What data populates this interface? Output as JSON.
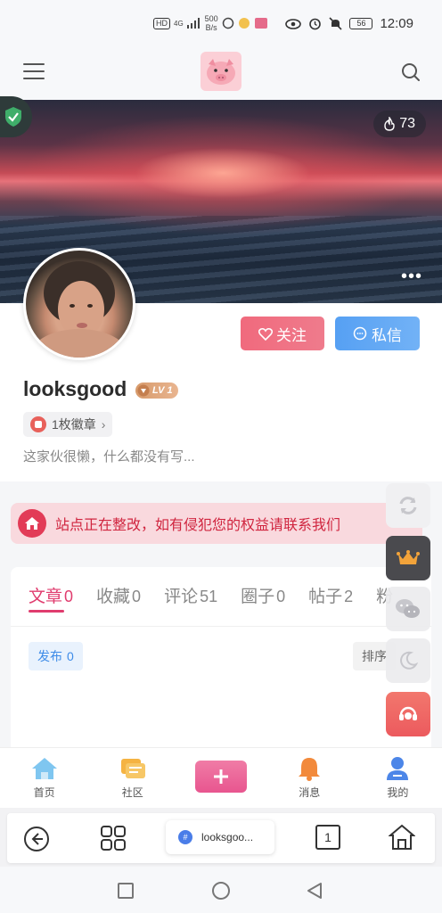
{
  "status_bar": {
    "network_badge": "HD",
    "signal_label": "4G",
    "speed_value": "500",
    "speed_unit": "B/s",
    "battery": "56",
    "time": "12:09"
  },
  "header": {
    "menu_icon": "hamburger-icon",
    "logo_icon": "pig-logo-icon",
    "search_icon": "search-icon"
  },
  "cover": {
    "heat_count": "73",
    "more_label": "•••"
  },
  "profile": {
    "follow_label": "关注",
    "message_label": "私信",
    "username": "looksgood",
    "level": "LV 1",
    "medals": "1枚徽章",
    "bio": "这家伙很懒，什么都没有写..."
  },
  "notice": {
    "text": "站点正在整改，如有侵犯您的权益请联系我们"
  },
  "tabs": [
    {
      "label": "文章",
      "count": "0",
      "active": true
    },
    {
      "label": "收藏",
      "count": "0"
    },
    {
      "label": "评论",
      "count": "51"
    },
    {
      "label": "圈子",
      "count": "0"
    },
    {
      "label": "帖子",
      "count": "2"
    },
    {
      "label": "粉",
      "count": ""
    }
  ],
  "filters": {
    "publish_label": "发布",
    "publish_count": "0",
    "sort_label": "排序"
  },
  "bottom_nav": [
    {
      "label": "首页",
      "icon": "home-icon"
    },
    {
      "label": "社区",
      "icon": "community-icon"
    },
    {
      "label": "",
      "icon": "plus-icon"
    },
    {
      "label": "消息",
      "icon": "bell-icon"
    },
    {
      "label": "我的",
      "icon": "user-icon"
    }
  ],
  "browser": {
    "url_text": "looksgoo...",
    "tab_count": "1"
  },
  "colors": {
    "accent": "#e03c6e",
    "follow": "#f06a7d",
    "message": "#56a0f3",
    "notice": "#d0253f"
  }
}
